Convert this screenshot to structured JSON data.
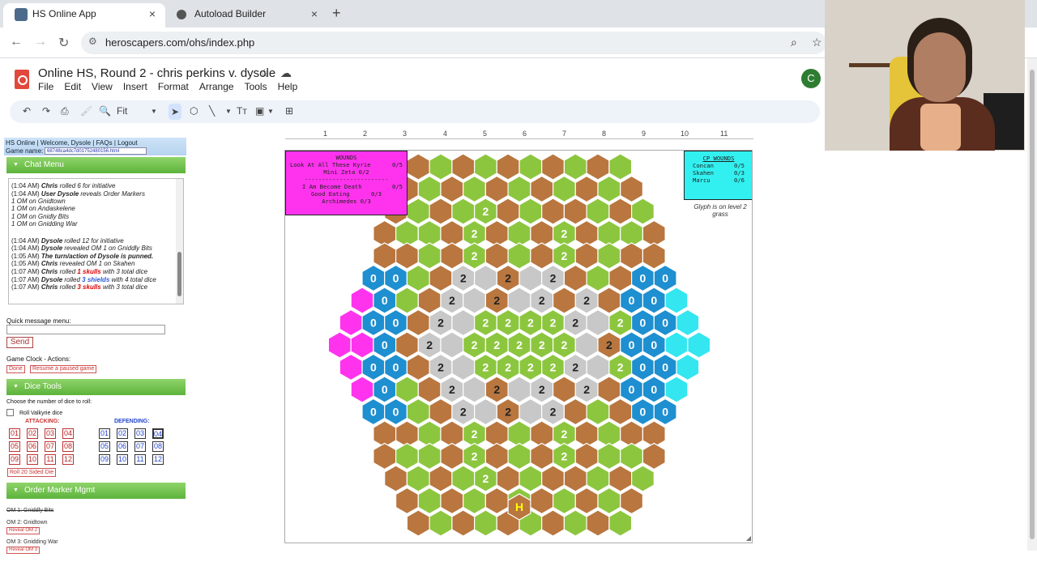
{
  "browser": {
    "tabs": [
      {
        "title": "HS Online App",
        "active": true
      },
      {
        "title": "Autoload Builder",
        "active": false
      }
    ],
    "url": "heroscapers.com/ohs/index.php",
    "new_tab": "+",
    "close": "×"
  },
  "doc": {
    "title": "Online HS, Round 2 - chris perkins v. dysole",
    "menus": [
      "File",
      "Edit",
      "View",
      "Insert",
      "Format",
      "Arrange",
      "Tools",
      "Help"
    ],
    "avatar": "C",
    "zoom": "Fit"
  },
  "ruler": [
    "1",
    "2",
    "3",
    "4",
    "5",
    "6",
    "7",
    "8",
    "9",
    "10",
    "11"
  ],
  "panel": {
    "links": "HS Online | Welcome, Dysole |  FAQs |  Logout",
    "game_name_label": "Game name:",
    "game_name_value": "68748ca4dc7d01752480156.html",
    "chat_menu": "Chat Menu",
    "chat": [
      {
        "t": "(1:04 AM)",
        "who": "Chris",
        "msg": " rolled 6 for initiative"
      },
      {
        "t": "(1:04 AM)",
        "who": "User Dysole",
        "msg": " reveals Order Markers"
      },
      {
        "t": "",
        "who": "",
        "msg": "1 OM on Gnidtown"
      },
      {
        "t": "",
        "who": "",
        "msg": "1 OM on Andaskelene"
      },
      {
        "t": "",
        "who": "",
        "msg": "1 OM on Gnidly Bits"
      },
      {
        "t": "",
        "who": "",
        "msg": "1 OM on Gnidding War"
      },
      {
        "t": "(1:04 AM)",
        "who": "Dysole",
        "msg": " rolled 12 for initiative"
      },
      {
        "t": "(1:04 AM)",
        "who": "Dysole",
        "msg": " revealed OM 1 on Gniddly Bits"
      },
      {
        "t": "(1:05 AM)",
        "who": "The turn/action of Dysole is punned.",
        "msg": ""
      },
      {
        "t": "(1:05 AM)",
        "who": "Chris",
        "msg": " revealed OM 1 on Skahen"
      },
      {
        "t": "(1:07 AM)",
        "who": "Chris",
        "msg": " rolled 1 skulls with 3 total dice"
      },
      {
        "t": "(1:07 AM)",
        "who": "Dysole",
        "msg": " rolled 3 shields with 4 total dice"
      },
      {
        "t": "(1:07 AM)",
        "who": "Chris",
        "msg": " rolled 3 skulls with 3 total dice"
      }
    ],
    "quick_message_label": "Quick message menu:",
    "send": "Send",
    "game_clock_label": "Game Clock - Actions:",
    "done": "Done",
    "resume": "Resume a paused game",
    "dice_tools": "Dice Tools",
    "choose_dice": "Choose the number of dice to roll:",
    "roll_valkyrie": "Roll Valkyrie dice",
    "attacking": "ATTACKING:",
    "defending": "DEFENDING:",
    "dice_numbers": [
      "01",
      "02",
      "03",
      "04",
      "05",
      "06",
      "07",
      "08",
      "09",
      "10",
      "11",
      "12"
    ],
    "roll20": "Roll 20 Sided Die",
    "order_marker": "Order Marker Mgmt",
    "om_lines": [
      {
        "label": "OM 1: Gniddly Bits",
        "btn": ""
      },
      {
        "label": "OM 2: Gnidtown",
        "btn": "Reveal OM 2"
      },
      {
        "label": "OM 3: Gnidding War",
        "btn": "Reveal OM 3"
      }
    ]
  },
  "map": {
    "wounds_title": "WOUNDS",
    "wounds_rows": [
      {
        "name": "Look At All These Kyrie",
        "val": "0/5"
      },
      {
        "name": "Mini Zeta  0/2",
        "val": ""
      },
      {
        "name": "------------------------",
        "val": ""
      },
      {
        "name": "I Am Become Death",
        "val": "0/5"
      },
      {
        "name": "Good Eating",
        "val": "0/3"
      },
      {
        "name": "Archimedes 0/3",
        "val": ""
      }
    ],
    "cp_title": "CP WOUNDS",
    "cp_rows": [
      {
        "name": "Concan",
        "val": "0/5"
      },
      {
        "name": "Skahen",
        "val": "0/3"
      },
      {
        "name": "Marcu",
        "val": "0/6"
      }
    ],
    "glyph_note": "Glyph is on level 2 grass",
    "start_marker": "H"
  },
  "colors": {
    "sand": "#b9763f",
    "grass": "#8cc63f",
    "rock": "#c8c8c8",
    "magenta": "#ff33ee",
    "cyan": "#33e6f0",
    "blue": "#1e8fd0",
    "dark": "#222222"
  }
}
